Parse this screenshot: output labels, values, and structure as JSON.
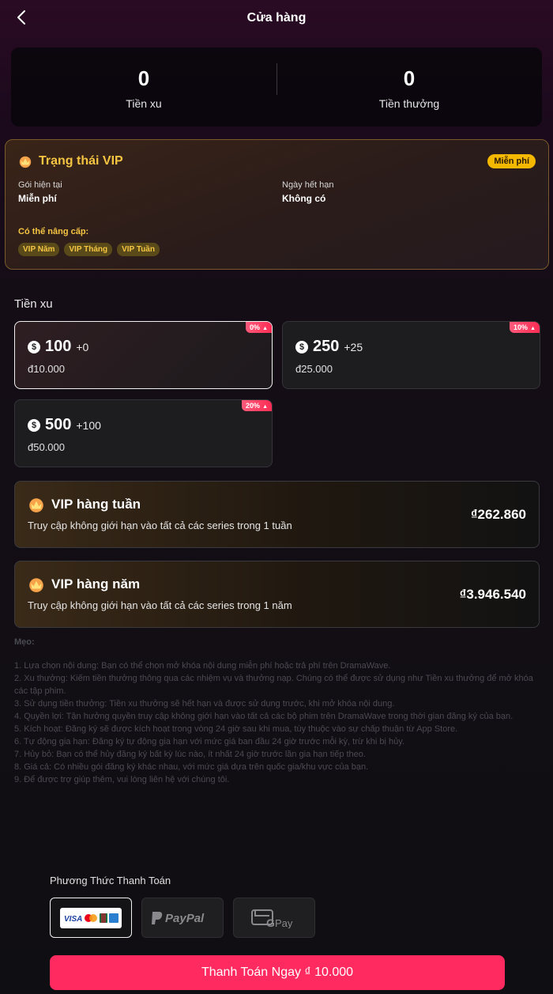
{
  "header": {
    "title": "Cửa hàng"
  },
  "balance": {
    "coins_value": "0",
    "coins_label": "Tiền xu",
    "bonus_value": "0",
    "bonus_label": "Tiền thưởng"
  },
  "vip_status": {
    "title": "Trạng thái VIP",
    "badge": "Miễn phí",
    "current_label": "Gói hiện tại",
    "current_value": "Miễn phí",
    "expiry_label": "Ngày hết hạn",
    "expiry_value": "Không có",
    "upgrade_label": "Có thể nâng cấp:",
    "upgrade_options": [
      "VIP Năm",
      "VIP Tháng",
      "VIP Tuần"
    ]
  },
  "coins_section": {
    "title": "Tiền xu",
    "packages": [
      {
        "amount": "100",
        "bonus": "+0",
        "price": "đ10.000",
        "discount": "0%",
        "selected": true
      },
      {
        "amount": "250",
        "bonus": "+25",
        "price": "đ25.000",
        "discount": "10%",
        "selected": false
      },
      {
        "amount": "500",
        "bonus": "+100",
        "price": "đ50.000",
        "discount": "20%",
        "selected": false
      }
    ]
  },
  "plans": [
    {
      "title": "VIP hàng tuần",
      "desc": "Truy cập không giới hạn vào tất cả các series trong 1 tuần",
      "price": "₫262.860"
    },
    {
      "title": "VIP hàng năm",
      "desc": "Truy cập không giới hạn vào tất cả các series trong 1 năm",
      "price": "₫3.946.540"
    }
  ],
  "tips": {
    "heading": "Mẹo:",
    "items": [
      "1. Lựa chọn nội dung: Bạn có thể chọn mở khóa nội dung miễn phí hoặc trả phí trên DramaWave.",
      "2. Xu thưởng: Kiếm tiền thưởng thông qua các nhiệm vụ và thưởng nạp. Chúng có thể được sử dụng như Tiền xu thưởng để mở khóa các tập phim.",
      "3. Sử dụng tiền thưởng: Tiền xu thưởng sẽ hết hạn và được sử dụng trước, khi mở khóa nội dung.",
      "4. Quyền lợi: Tận hưởng quyền truy cập không giới hạn vào tất cả các bộ phim trên DramaWave trong thời gian đăng ký của bạn.",
      "5. Kích hoạt: Đăng ký sẽ được kích hoạt trong vòng 24 giờ sau khi mua, tùy thuộc vào sự chấp thuận từ App Store.",
      "6. Tự động gia hạn: Đăng ký tự động gia hạn với mức giá ban đầu 24 giờ trước mỗi kỳ, trừ khi bị hủy.",
      "7. Hủy bỏ: Bạn có thể hủy đăng ký bất kỳ lúc nào, ít nhất 24 giờ trước lần gia hạn tiếp theo.",
      "8. Giá cả: Có nhiều gói đăng ký khác nhau, với mức giá dựa trên quốc gia/khu vực của bạn.",
      "9. Để được trợ giúp thêm, vui lòng liên hệ với chúng tôi."
    ]
  },
  "payment": {
    "label": "Phương Thức Thanh Toán",
    "methods": [
      {
        "name": "card",
        "card_brands": [
          "VISA"
        ],
        "selected": true
      },
      {
        "name": "PayPal",
        "selected": false
      },
      {
        "name": "GPay",
        "text": "Pay",
        "selected": false
      }
    ],
    "button_label": "Thanh Toán Ngay ₫ 10.000"
  },
  "colors": {
    "accent": "#ff2a5f",
    "gold": "#f5c542",
    "badge": "#f5b800"
  }
}
